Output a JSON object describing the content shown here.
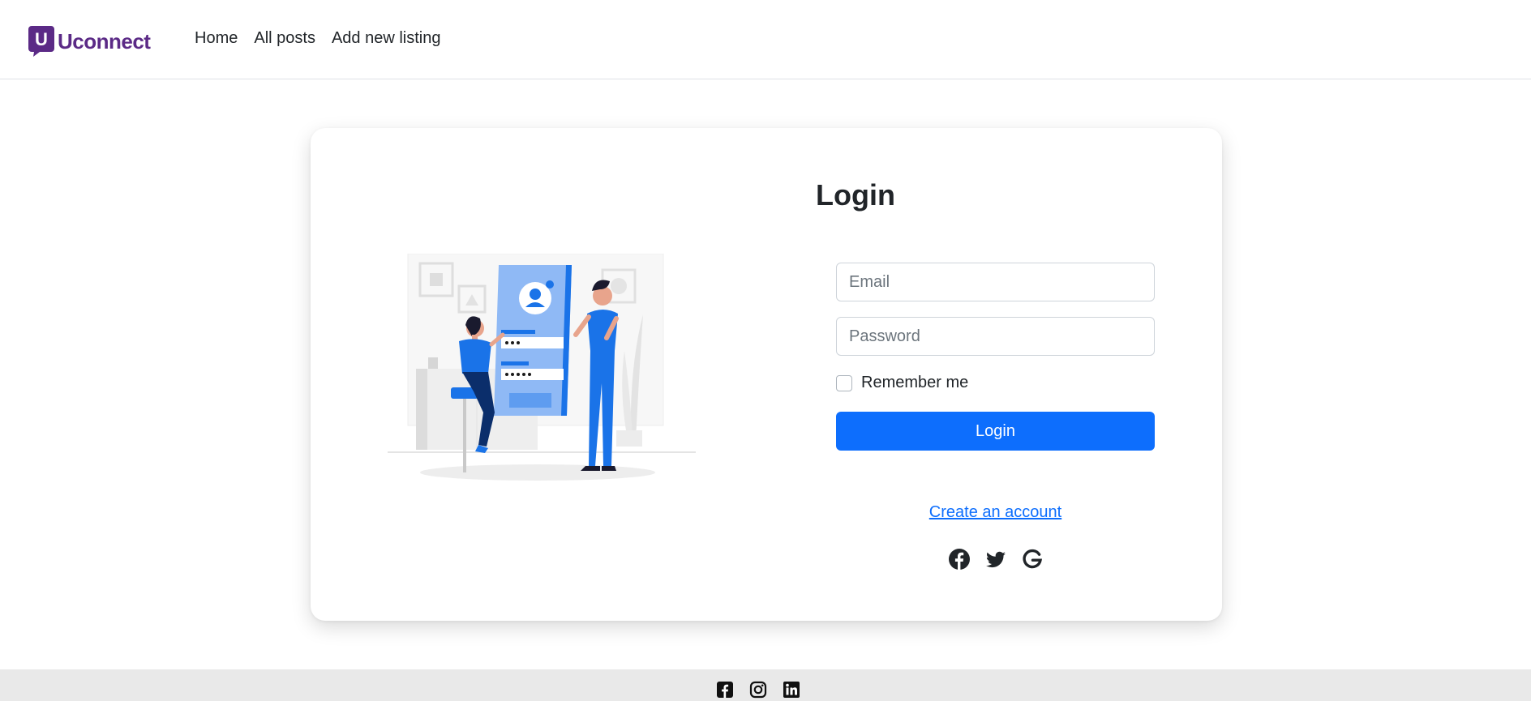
{
  "navbar": {
    "brand_mark": "U",
    "brand_name": "Uconnect",
    "links": [
      "Home",
      "All posts",
      "Add new listing"
    ]
  },
  "login": {
    "title": "Login",
    "email_placeholder": "Email",
    "password_placeholder": "Password",
    "remember_label": "Remember me",
    "remember_checked": false,
    "submit_label": "Login",
    "create_account_label": "Create an account",
    "social_icons": [
      "facebook-icon",
      "twitter-icon",
      "google-icon"
    ]
  },
  "footer": {
    "icons": [
      "facebook-square-icon",
      "instagram-icon",
      "linkedin-icon"
    ]
  },
  "colors": {
    "brand": "#5b2a86",
    "primary": "#0d6efd",
    "illustration_blue": "#1a73e8",
    "footer_bg": "#e9e9e9"
  }
}
